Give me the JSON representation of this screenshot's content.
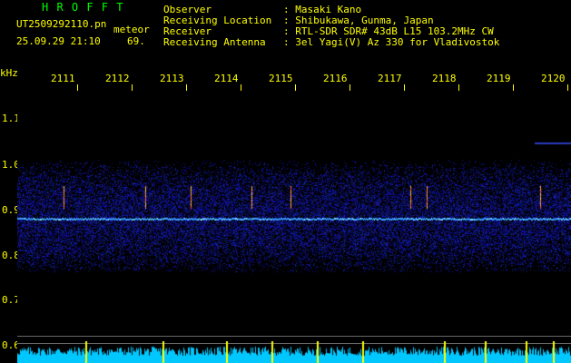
{
  "header": {
    "brand": "H R O F F T",
    "filename": "UT2509292110.pn",
    "type_label": "meteor",
    "datetime": "25.09.29 21:10",
    "count": "69."
  },
  "info": {
    "rows": [
      {
        "label": "Observer",
        "value": ": Masaki Kano"
      },
      {
        "label": "Receiving Location",
        "value": ": Shibukawa, Gunma, Japan"
      },
      {
        "label": "Receiver",
        "value": ": RTL-SDR SDR# 43dB L15 103.2MHz CW"
      },
      {
        "label": "Receiving Antenna",
        "value": ": 3el Yagi(V) Az 330 for Vladivostok"
      }
    ]
  },
  "axis": {
    "unit": "kHz",
    "y_ticks": [
      "1.1",
      "1.0",
      "0.9",
      "0.8",
      "0.7",
      "0.6"
    ],
    "x_ticks": [
      "2111",
      "2112",
      "2113",
      "2114",
      "2115",
      "2116",
      "2117",
      "2118",
      "2119",
      "2120"
    ]
  },
  "colors": {
    "background": "#000000",
    "label": "#ffff00",
    "brand": "#00ff00",
    "text": "#ffffff",
    "noise_band": "#0a1a8a",
    "carrier_line": "#3aa0ff",
    "power_bar": "#00c8ff"
  }
}
